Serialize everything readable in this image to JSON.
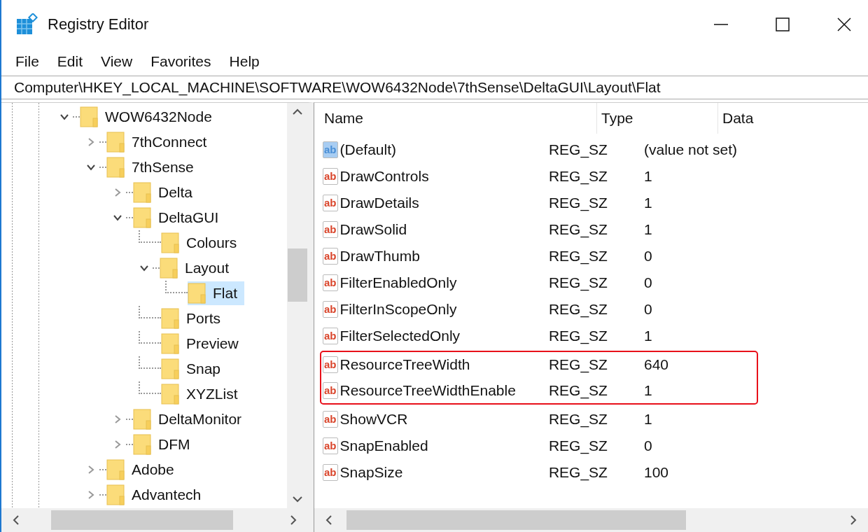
{
  "window": {
    "title": "Registry Editor"
  },
  "menu": [
    {
      "label": "File"
    },
    {
      "label": "Edit"
    },
    {
      "label": "View"
    },
    {
      "label": "Favorites"
    },
    {
      "label": "Help"
    }
  ],
  "address_bar": {
    "value": "Computer\\HKEY_LOCAL_MACHINE\\SOFTWARE\\WOW6432Node\\7thSense\\DeltaGUI\\Layout\\Flat"
  },
  "tree": {
    "items": [
      {
        "label": "WOW6432Node",
        "expanded": true,
        "selected": false,
        "children": [
          {
            "label": "7thConnect",
            "expanded": false,
            "selected": false
          },
          {
            "label": "7thSense",
            "expanded": true,
            "selected": false,
            "children": [
              {
                "label": "Delta",
                "expanded": false,
                "selected": false
              },
              {
                "label": "DeltaGUI",
                "expanded": true,
                "selected": false,
                "children": [
                  {
                    "label": "Colours",
                    "selected": false
                  },
                  {
                    "label": "Layout",
                    "expanded": true,
                    "selected": false,
                    "children": [
                      {
                        "label": "Flat",
                        "selected": true
                      }
                    ]
                  },
                  {
                    "label": "Ports",
                    "selected": false
                  },
                  {
                    "label": "Preview",
                    "selected": false
                  },
                  {
                    "label": "Snap",
                    "selected": false
                  },
                  {
                    "label": "XYZList",
                    "selected": false
                  }
                ]
              },
              {
                "label": "DeltaMonitor",
                "expanded": false,
                "selected": false
              },
              {
                "label": "DFM",
                "expanded": false,
                "selected": false
              }
            ]
          },
          {
            "label": "Adobe",
            "expanded": false,
            "selected": false
          },
          {
            "label": "Advantech",
            "expanded": false,
            "selected": false
          }
        ]
      }
    ]
  },
  "table": {
    "columns": [
      "Name",
      "Type",
      "Data"
    ],
    "rows": [
      {
        "kind": "default",
        "icon_label": "ab",
        "name": "(Default)",
        "type": "REG_SZ",
        "data": "(value not set)",
        "highlighted": false
      },
      {
        "kind": "string",
        "icon_label": "ab",
        "name": "DrawControls",
        "type": "REG_SZ",
        "data": "1",
        "highlighted": false
      },
      {
        "kind": "string",
        "icon_label": "ab",
        "name": "DrawDetails",
        "type": "REG_SZ",
        "data": "1",
        "highlighted": false
      },
      {
        "kind": "string",
        "icon_label": "ab",
        "name": "DrawSolid",
        "type": "REG_SZ",
        "data": "1",
        "highlighted": false
      },
      {
        "kind": "string",
        "icon_label": "ab",
        "name": "DrawThumb",
        "type": "REG_SZ",
        "data": "0",
        "highlighted": false
      },
      {
        "kind": "string",
        "icon_label": "ab",
        "name": "FilterEnabledOnly",
        "type": "REG_SZ",
        "data": "0",
        "highlighted": false
      },
      {
        "kind": "string",
        "icon_label": "ab",
        "name": "FilterInScopeOnly",
        "type": "REG_SZ",
        "data": "0",
        "highlighted": false
      },
      {
        "kind": "string",
        "icon_label": "ab",
        "name": "FilterSelectedOnly",
        "type": "REG_SZ",
        "data": "1",
        "highlighted": false
      },
      {
        "kind": "string",
        "icon_label": "ab",
        "name": "ResourceTreeWidth",
        "type": "REG_SZ",
        "data": "640",
        "highlighted": true
      },
      {
        "kind": "string",
        "icon_label": "ab",
        "name": "ResourceTreeWidthEnable",
        "type": "REG_SZ",
        "data": "1",
        "highlighted": true
      },
      {
        "kind": "string",
        "icon_label": "ab",
        "name": "ShowVCR",
        "type": "REG_SZ",
        "data": "1",
        "highlighted": false
      },
      {
        "kind": "string",
        "icon_label": "ab",
        "name": "SnapEnabled",
        "type": "REG_SZ",
        "data": "0",
        "highlighted": false
      },
      {
        "kind": "string",
        "icon_label": "ab",
        "name": "SnapSize",
        "type": "REG_SZ",
        "data": "100",
        "highlighted": false
      }
    ]
  }
}
